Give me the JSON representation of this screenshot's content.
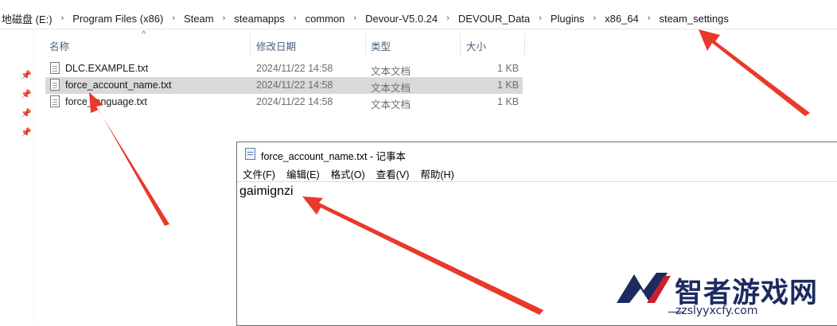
{
  "breadcrumb": {
    "items": [
      "地磁盘 (E:)",
      "Program Files (x86)",
      "Steam",
      "steamapps",
      "common",
      "Devour-V5.0.24",
      "DEVOUR_Data",
      "Plugins",
      "x86_64",
      "steam_settings"
    ]
  },
  "file_list": {
    "columns": {
      "name": "名称",
      "modified": "修改日期",
      "type": "类型",
      "size": "大小"
    },
    "rows": [
      {
        "name": "DLC.EXAMPLE.txt",
        "modified": "2024/11/22 14:58",
        "type": "文本文档",
        "size": "1 KB"
      },
      {
        "name": "force_account_name.txt",
        "modified": "2024/11/22 14:58",
        "type": "文本文档",
        "size": "1 KB"
      },
      {
        "name": "force_language.txt",
        "modified": "2024/11/22 14:58",
        "type": "文本文档",
        "size": "1 KB"
      }
    ]
  },
  "notepad": {
    "title": "force_account_name.txt - 记事本",
    "menu": [
      "文件(F)",
      "编辑(E)",
      "格式(O)",
      "查看(V)",
      "帮助(H)"
    ],
    "content": "gaimignzi"
  },
  "watermark": {
    "name": "智者游戏网",
    "url": "zzslyyxcfy.com"
  },
  "colors": {
    "arrow": "#e8392a",
    "brand": "#1c2a5e",
    "selected_row": "#d9d9d9"
  }
}
